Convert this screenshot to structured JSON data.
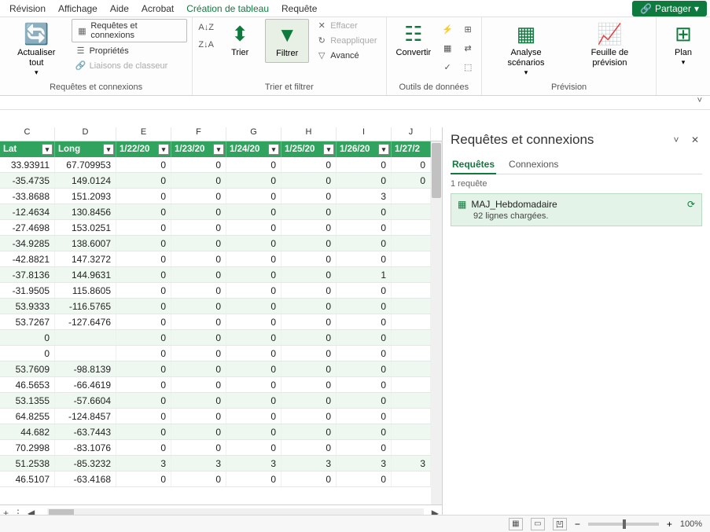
{
  "menubar": {
    "items": [
      "Révision",
      "Affichage",
      "Aide",
      "Acrobat",
      "Création de tableau",
      "Requête"
    ],
    "active_index": 4,
    "share": "Partager"
  },
  "ribbon": {
    "group_connections": {
      "title": "Requêtes et connexions",
      "refresh_all": "Actualiser tout",
      "queries_connections": "Requêtes et connexions",
      "properties": "Propriétés",
      "edit_links": "Liaisons de classeur"
    },
    "group_sort_filter": {
      "title": "Trier et filtrer",
      "sort": "Trier",
      "filter": "Filtrer",
      "clear": "Effacer",
      "reapply": "Reappliquer",
      "advanced": "Avancé"
    },
    "group_data_tools": {
      "title": "Outils de données",
      "convert": "Convertir"
    },
    "group_forecast": {
      "title": "Prévision",
      "scenario": "Analyse scénarios",
      "forecast_sheet": "Feuille de prévision"
    },
    "group_outline": {
      "plan": "Plan"
    }
  },
  "columns": {
    "letters": [
      "C",
      "D",
      "E",
      "F",
      "G",
      "H",
      "I",
      "J"
    ]
  },
  "headers": [
    "Lat",
    "Long",
    "1/22/20",
    "1/23/20",
    "1/24/20",
    "1/25/20",
    "1/26/20",
    "1/27/2"
  ],
  "rows": [
    [
      "33.93911",
      "67.709953",
      "0",
      "0",
      "0",
      "0",
      "0",
      "0"
    ],
    [
      "-35.4735",
      "149.0124",
      "0",
      "0",
      "0",
      "0",
      "0",
      "0"
    ],
    [
      "-33.8688",
      "151.2093",
      "0",
      "0",
      "0",
      "0",
      "3",
      ""
    ],
    [
      "-12.4634",
      "130.8456",
      "0",
      "0",
      "0",
      "0",
      "0",
      ""
    ],
    [
      "-27.4698",
      "153.0251",
      "0",
      "0",
      "0",
      "0",
      "0",
      ""
    ],
    [
      "-34.9285",
      "138.6007",
      "0",
      "0",
      "0",
      "0",
      "0",
      ""
    ],
    [
      "-42.8821",
      "147.3272",
      "0",
      "0",
      "0",
      "0",
      "0",
      ""
    ],
    [
      "-37.8136",
      "144.9631",
      "0",
      "0",
      "0",
      "0",
      "1",
      ""
    ],
    [
      "-31.9505",
      "115.8605",
      "0",
      "0",
      "0",
      "0",
      "0",
      ""
    ],
    [
      "53.9333",
      "-116.5765",
      "0",
      "0",
      "0",
      "0",
      "0",
      ""
    ],
    [
      "53.7267",
      "-127.6476",
      "0",
      "0",
      "0",
      "0",
      "0",
      ""
    ],
    [
      "0",
      "",
      "0",
      "0",
      "0",
      "0",
      "0",
      ""
    ],
    [
      "0",
      "",
      "0",
      "0",
      "0",
      "0",
      "0",
      ""
    ],
    [
      "53.7609",
      "-98.8139",
      "0",
      "0",
      "0",
      "0",
      "0",
      ""
    ],
    [
      "46.5653",
      "-66.4619",
      "0",
      "0",
      "0",
      "0",
      "0",
      ""
    ],
    [
      "53.1355",
      "-57.6604",
      "0",
      "0",
      "0",
      "0",
      "0",
      ""
    ],
    [
      "64.8255",
      "-124.8457",
      "0",
      "0",
      "0",
      "0",
      "0",
      ""
    ],
    [
      "44.682",
      "-63.7443",
      "0",
      "0",
      "0",
      "0",
      "0",
      ""
    ],
    [
      "70.2998",
      "-83.1076",
      "0",
      "0",
      "0",
      "0",
      "0",
      ""
    ],
    [
      "51.2538",
      "-85.3232",
      "3",
      "3",
      "3",
      "3",
      "3",
      "3"
    ],
    [
      "46.5107",
      "-63.4168",
      "0",
      "0",
      "0",
      "0",
      "0",
      ""
    ]
  ],
  "side_panel": {
    "title": "Requêtes et connexions",
    "tabs": {
      "queries": "Requêtes",
      "connections": "Connexions"
    },
    "count_label": "1 requête",
    "query": {
      "name": "MAJ_Hebdomadaire",
      "detail": "92 lignes chargées."
    }
  },
  "status": {
    "zoom": "100%"
  }
}
